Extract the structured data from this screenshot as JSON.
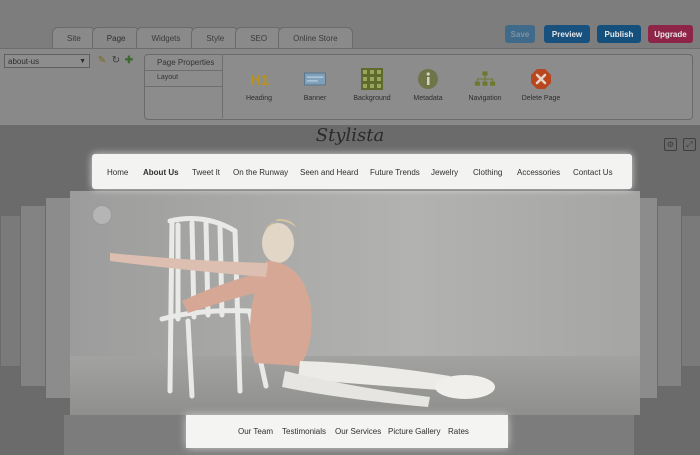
{
  "editor": {
    "tabs": [
      {
        "label": "Site"
      },
      {
        "label": "Page"
      },
      {
        "label": "Widgets"
      },
      {
        "label": "Style"
      },
      {
        "label": "SEO"
      },
      {
        "label": "Online Store"
      }
    ],
    "active_tab": "Page",
    "buttons": {
      "save": "Save",
      "preview": "Preview",
      "publish": "Publish",
      "upgrade": "Upgrade"
    },
    "page_select": {
      "value": "about-us"
    },
    "panel": {
      "title": "Page Properties",
      "layout_label": "Layout",
      "tools": [
        {
          "label": "Heading",
          "icon": "h1-heading-icon"
        },
        {
          "label": "Banner",
          "icon": "banner-icon"
        },
        {
          "label": "Background",
          "icon": "background-grid-icon"
        },
        {
          "label": "Metadata",
          "icon": "info-icon"
        },
        {
          "label": "Navigation",
          "icon": "sitemap-icon"
        },
        {
          "label": "Delete Page",
          "icon": "delete-icon"
        }
      ]
    }
  },
  "site": {
    "logo": "Stylista",
    "nav": [
      {
        "label": "Home"
      },
      {
        "label": "About Us"
      },
      {
        "label": "Tweet It"
      },
      {
        "label": "On the Runway"
      },
      {
        "label": "Seen and Heard"
      },
      {
        "label": "Future Trends"
      },
      {
        "label": "Jewelry"
      },
      {
        "label": "Clothing"
      },
      {
        "label": "Accessories"
      },
      {
        "label": "Contact Us"
      }
    ],
    "active_nav": "About Us",
    "subnav": [
      {
        "label": "Our Team"
      },
      {
        "label": "Testimonials"
      },
      {
        "label": "Our Services"
      },
      {
        "label": "Picture Gallery"
      },
      {
        "label": "Rates"
      }
    ]
  },
  "colors": {
    "preview": "#18507e",
    "publish": "#15507d",
    "upgrade": "#8e2448",
    "heading_icon": "#b8921c",
    "delete_icon": "#b8461e"
  }
}
